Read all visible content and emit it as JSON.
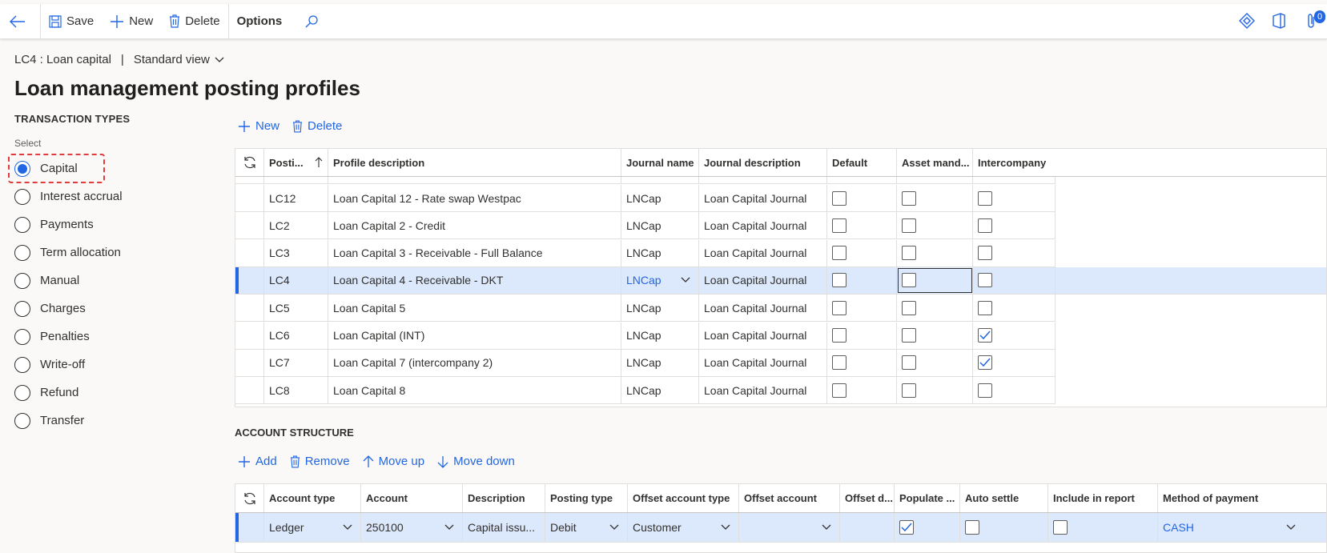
{
  "toolbar": {
    "save": "Save",
    "new": "New",
    "delete": "Delete",
    "options": "Options",
    "notification_count": "0"
  },
  "breadcrumb": {
    "record": "LC4 : Loan capital",
    "separator": "|",
    "view": "Standard view"
  },
  "page_title": "Loan management posting profiles",
  "transaction_types": {
    "heading": "TRANSACTION TYPES",
    "select_label": "Select",
    "options": [
      "Capital",
      "Interest accrual",
      "Payments",
      "Term allocation",
      "Manual",
      "Charges",
      "Penalties",
      "Write-off",
      "Refund",
      "Transfer"
    ],
    "selected": "Capital"
  },
  "profiles_actions": {
    "new": "New",
    "delete": "Delete"
  },
  "profiles_grid": {
    "headers": [
      "Posti...",
      "Profile description",
      "Journal name",
      "Journal description",
      "Default",
      "Asset mand...",
      "Intercompany"
    ],
    "rows": [
      {
        "code": "LC12",
        "desc": "Loan Capital 12 - Rate swap Westpac",
        "journal": "LNCap",
        "jdesc": "Loan Capital Journal",
        "default": false,
        "asset": false,
        "ic": false
      },
      {
        "code": "LC2",
        "desc": "Loan Capital 2 - Credit",
        "journal": "LNCap",
        "jdesc": "Loan Capital Journal",
        "default": false,
        "asset": false,
        "ic": false
      },
      {
        "code": "LC3",
        "desc": "Loan Capital 3 - Receivable - Full Balance",
        "journal": "LNCap",
        "jdesc": "Loan Capital Journal",
        "default": false,
        "asset": false,
        "ic": false
      },
      {
        "code": "LC4",
        "desc": "Loan Capital 4 - Receivable - DKT",
        "journal": "LNCap",
        "jdesc": "Loan Capital Journal",
        "default": false,
        "asset": false,
        "ic": false
      },
      {
        "code": "LC5",
        "desc": "Loan Capital 5",
        "journal": "LNCap",
        "jdesc": "Loan Capital Journal",
        "default": false,
        "asset": false,
        "ic": false
      },
      {
        "code": "LC6",
        "desc": "Loan Capital (INT)",
        "journal": "LNCap",
        "jdesc": "Loan Capital Journal",
        "default": false,
        "asset": false,
        "ic": true
      },
      {
        "code": "LC7",
        "desc": "Loan Capital 7 (intercompany 2)",
        "journal": "LNCap",
        "jdesc": "Loan Capital Journal",
        "default": false,
        "asset": false,
        "ic": true
      },
      {
        "code": "LC8",
        "desc": "Loan Capital 8",
        "journal": "LNCap",
        "jdesc": "Loan Capital Journal",
        "default": false,
        "asset": false,
        "ic": false
      }
    ],
    "selected_code": "LC4"
  },
  "account_structure": {
    "heading": "ACCOUNT STRUCTURE",
    "actions": {
      "add": "Add",
      "remove": "Remove",
      "move_up": "Move up",
      "move_down": "Move down"
    },
    "headers": [
      "Account type",
      "Account",
      "Description",
      "Posting type",
      "Offset account type",
      "Offset account",
      "Offset d...",
      "Populate ...",
      "Auto settle",
      "Include in report",
      "Method of payment"
    ],
    "row": {
      "account_type": "Ledger",
      "account": "250100",
      "description": "Capital issu...",
      "posting_type": "Debit",
      "offset_account_type": "Customer",
      "offset_account": "",
      "populate": true,
      "auto_settle": false,
      "include_in_report": false,
      "method_of_payment": "CASH"
    }
  },
  "colors": {
    "accent": "#2266e3",
    "selected_row": "#dce8fb",
    "highlight": "#e03c3c"
  }
}
